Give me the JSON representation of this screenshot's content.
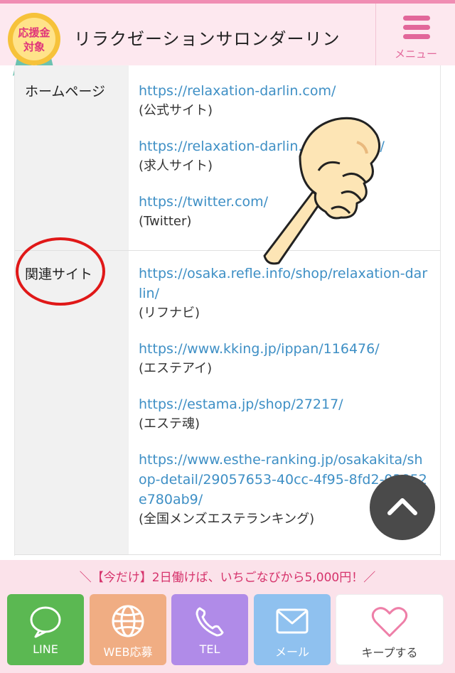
{
  "header": {
    "badge_line1": "応援金",
    "badge_line2": "対象",
    "title": "リラクゼーションサロンダーリン",
    "menu_label": "メニュー"
  },
  "info_table": {
    "rows": [
      {
        "label": "ホームページ",
        "entries": [
          {
            "url": "https://relaxation-darlin.com/",
            "note": "(公式サイト)"
          },
          {
            "url": "https://relaxation-darlin.com/recruit/",
            "note": "(求人サイト)"
          },
          {
            "url": "https://twitter.com/",
            "note": "(Twitter)"
          }
        ]
      },
      {
        "label": "関連サイト",
        "entries": [
          {
            "url": "https://osaka.refle.info/shop/relaxation-darlin/",
            "note": "(リフナビ)"
          },
          {
            "url": "https://www.kking.jp/ippan/116476/",
            "note": "(エステアイ)"
          },
          {
            "url": "https://estama.jp/shop/27217/",
            "note": "(エステ魂)"
          },
          {
            "url": "https://www.esthe-ranking.jp/osakakita/shop-detail/29057653-40cc-4f95-8fd2-03852e780ab9/",
            "note": "(全国メンズエステランキング)"
          }
        ]
      }
    ]
  },
  "footer": {
    "promo": "＼【今だけ】2日働けば、いちごなびから5,000円！／",
    "buttons": {
      "line": "LINE",
      "web": "WEB応募",
      "tel": "TEL",
      "mail": "メール",
      "keep": "キープする"
    }
  },
  "colors": {
    "accent_pink": "#e2679a",
    "link_blue": "#3e8fc5",
    "line_green": "#5bb852",
    "web_orange": "#f0ad83",
    "tel_purple": "#b08be8",
    "mail_blue": "#8fc1ef",
    "highlight_red": "#e01818"
  },
  "icons": [
    "badge-ribbon-icon",
    "hamburger-icon",
    "pointing-hand-icon",
    "chevron-up-icon",
    "chat-bubble-icon",
    "globe-icon",
    "phone-icon",
    "envelope-icon",
    "heart-icon"
  ]
}
